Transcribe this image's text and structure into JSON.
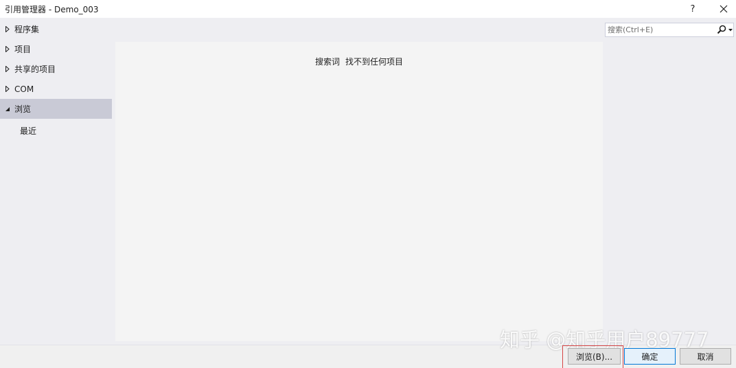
{
  "window": {
    "title": "引用管理器 - Demo_003",
    "help_label": "?",
    "close_label": "✕"
  },
  "nav": {
    "items": [
      {
        "label": "程序集",
        "expanded": false,
        "selected": false
      },
      {
        "label": "项目",
        "expanded": false,
        "selected": false
      },
      {
        "label": "共享的项目",
        "expanded": false,
        "selected": false
      },
      {
        "label": "COM",
        "expanded": false,
        "selected": false
      },
      {
        "label": "浏览",
        "expanded": true,
        "selected": true
      }
    ],
    "sub_items": [
      {
        "label": "最近"
      }
    ]
  },
  "content": {
    "empty_prefix": "搜索词",
    "empty_message": "找不到任何项目"
  },
  "search": {
    "placeholder": "搜索(Ctrl+E)",
    "value": "",
    "icon": "search-icon"
  },
  "buttons": {
    "browse": "浏览(B)...",
    "ok": "确定",
    "cancel": "取消"
  },
  "watermark": "知乎 @知乎用户89777",
  "colors": {
    "selected_bg": "#c9cad6",
    "content_bg": "#f4f4f4",
    "pane_bg": "#eeeef2",
    "highlight": "#d64545",
    "ok_border": "#0078d7"
  }
}
